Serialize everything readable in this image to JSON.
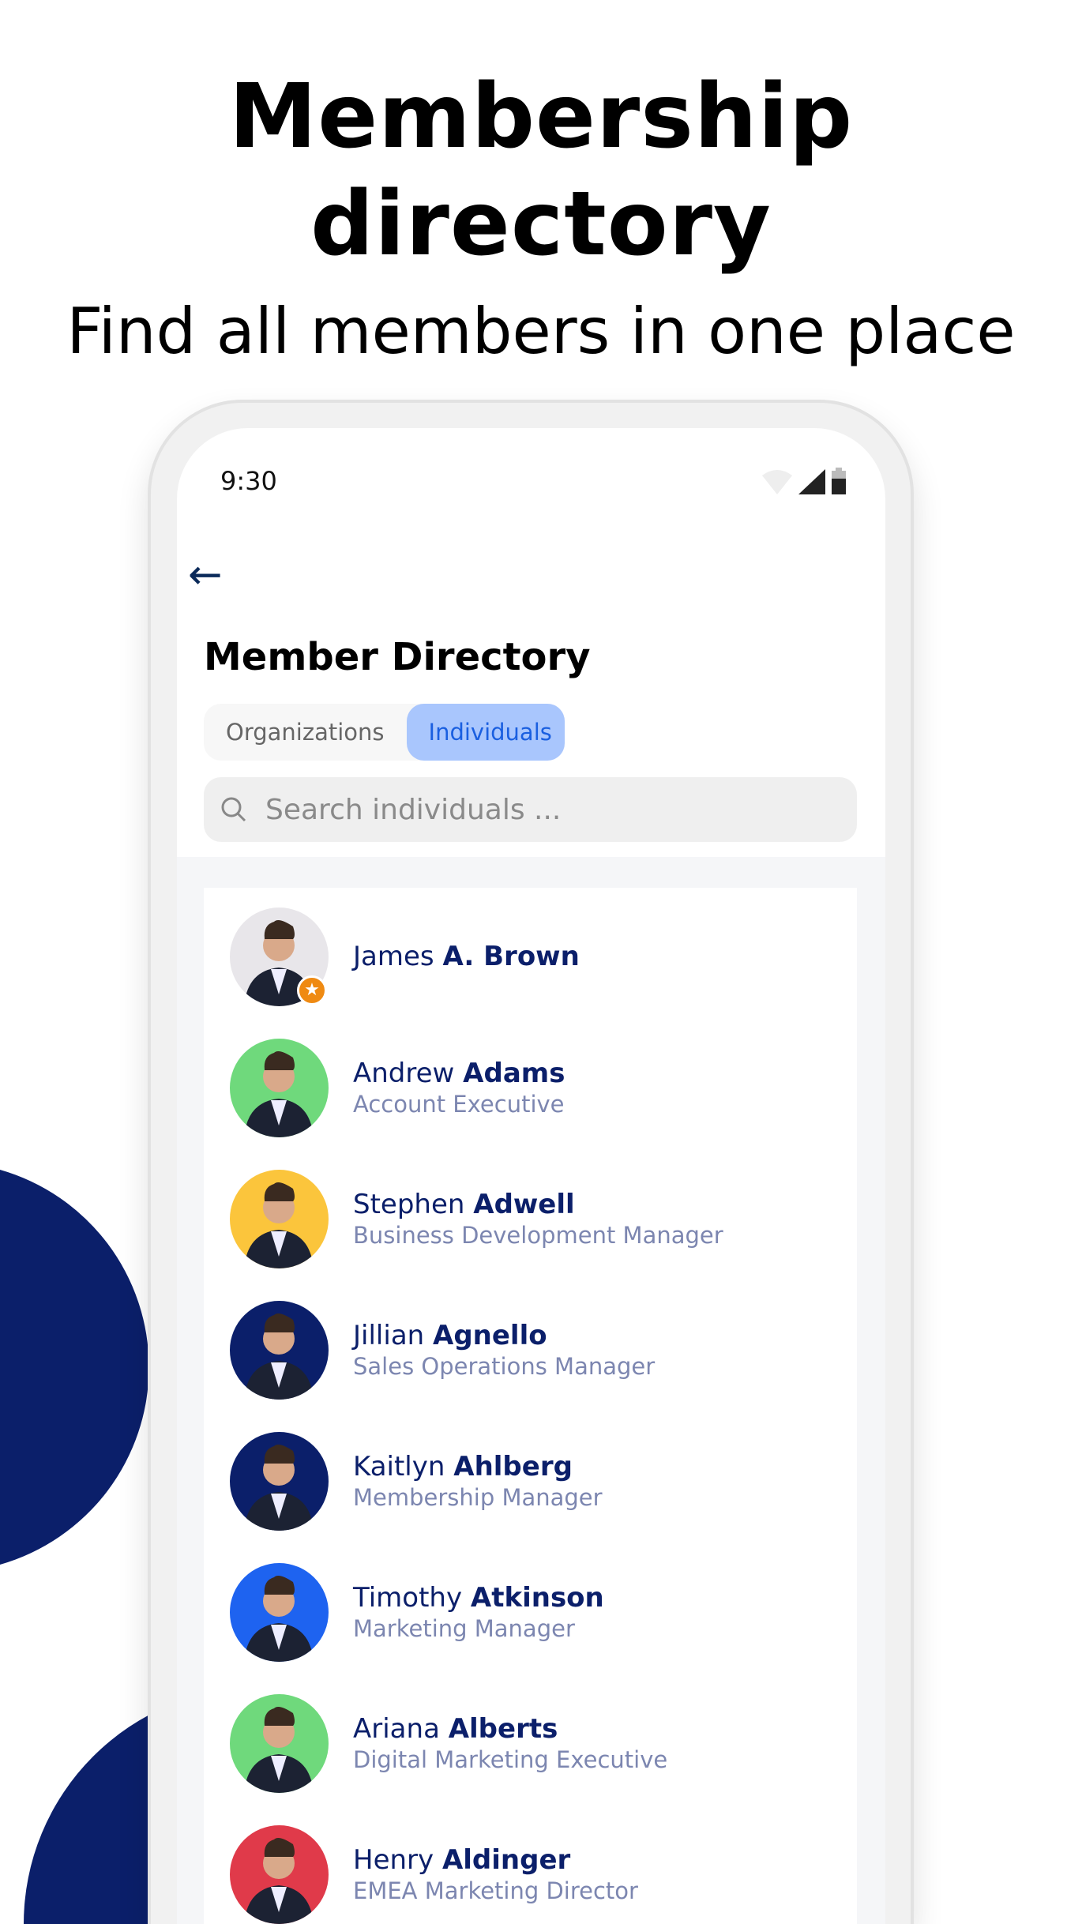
{
  "hero": {
    "title": "Membership directory",
    "subtitle": "Find all members in one place"
  },
  "status_bar": {
    "time": "9:30"
  },
  "header": {
    "back_icon": "arrow-left-icon",
    "title": "Member Directory"
  },
  "tabs": [
    {
      "label": "Organizations",
      "active": false
    },
    {
      "label": "Individuals",
      "active": true
    }
  ],
  "search": {
    "placeholder": "Search individuals ..."
  },
  "colors": {
    "navy": "#0b1f6a",
    "tab_active_bg": "#a9c6fd",
    "tab_active_text": "#1a5fe0",
    "badge": "#ef8a12"
  },
  "members": [
    {
      "first": "James",
      "last": "A. Brown",
      "role": "",
      "bg": "#e8e6ea",
      "badge": "star-icon"
    },
    {
      "first": "Andrew",
      "last": "Adams",
      "role": "Account Executive",
      "bg": "#6fd97c"
    },
    {
      "first": "Stephen",
      "last": "Adwell",
      "role": "Business Development Manager",
      "bg": "#fbc53c"
    },
    {
      "first": "Jillian",
      "last": "Agnello",
      "role": "Sales Operations Manager",
      "bg": "#0b1f6a"
    },
    {
      "first": "Kaitlyn",
      "last": "Ahlberg",
      "role": "Membership Manager",
      "bg": "#0b1f6a"
    },
    {
      "first": "Timothy",
      "last": "Atkinson",
      "role": "Marketing Manager",
      "bg": "#1e63f0"
    },
    {
      "first": "Ariana",
      "last": "Alberts",
      "role": "Digital Marketing Executive",
      "bg": "#6fd97c"
    },
    {
      "first": "Henry",
      "last": "Aldinger",
      "role": "EMEA Marketing Director",
      "bg": "#e03a4a"
    }
  ]
}
